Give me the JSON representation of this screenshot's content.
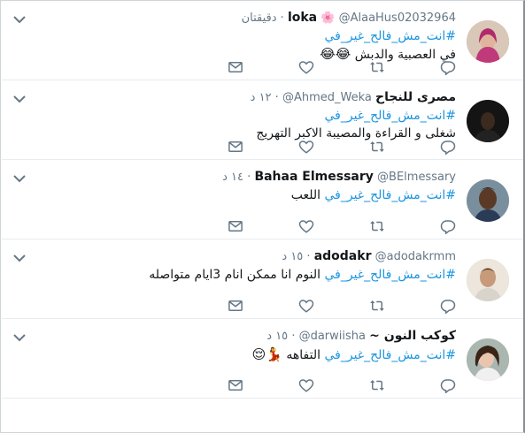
{
  "tweets": [
    {
      "name": "loka",
      "flower": "🌸",
      "handle": "@AlaaHus02032964",
      "dot": "·",
      "time": "دقيقتان",
      "hashtag": "#انت_مش_فالح_غير_في",
      "text": "في العصبية والدبش",
      "emoji": "😂😂"
    },
    {
      "name": "مصرى للنجاح",
      "handle": "@Ahmed_Weka",
      "dot": "·",
      "time": "١٢ د",
      "hashtag": "#انت_مش_فالح_غير_في",
      "text": "شغلى و القراءة والمصيبة الاكبر التهريج",
      "emoji": ""
    },
    {
      "name": "Bahaa Elmessary",
      "handle": "@BElmessary",
      "dot": "·",
      "time": "١٤ د",
      "hashtag": "#انت_مش_فالح_غير_في",
      "text": "اللعب",
      "emoji": ""
    },
    {
      "name": "adodakr",
      "handle": "@adodakrmm",
      "dot": "·",
      "time": "١٥ د",
      "hashtag": "#انت_مش_فالح_غير_في",
      "text": "النوم انا ممكن انام 3ايام متواصله",
      "emoji": ""
    },
    {
      "name": "كوكب النون ~",
      "handle": "@darwiisha",
      "dot": "·",
      "time": "١٥ د",
      "hashtag": "#انت_مش_فالح_غير_في",
      "text": "التفاهه",
      "emoji": "💃😌"
    }
  ],
  "icons": {
    "reply": "reply-icon",
    "retweet": "retweet-icon",
    "like": "like-icon",
    "dm": "direct-message-icon",
    "menu": "chevron-down-icon"
  },
  "colors": {
    "hashtag": "#1b95e0",
    "muted": "#657786",
    "icon": "#657786",
    "divider": "#e6ecf0"
  }
}
